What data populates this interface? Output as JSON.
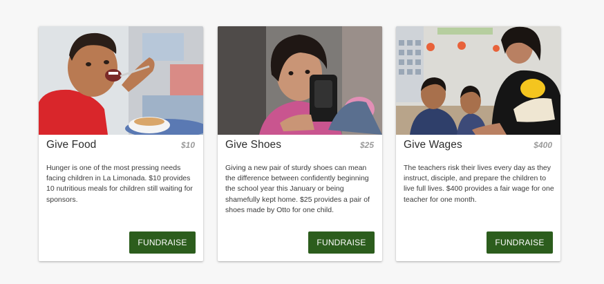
{
  "cards": [
    {
      "image": "boy-eating-food-photo",
      "title": "Give Food",
      "amount": "$10",
      "description": "Hunger is one of the most pressing needs facing children in La Limonada. $10 provides 10 nutritious meals for children still waiting for sponsors.",
      "button_label": "FUNDRAISE"
    },
    {
      "image": "girl-holding-shoes-photo",
      "title": "Give Shoes",
      "amount": "$25",
      "description": "Giving a new pair of sturdy shoes can mean the difference between confidently beginning the school year this January or being shamefully kept home. $25 provides a pair of shoes made by Otto for one child.",
      "button_label": "FUNDRAISE"
    },
    {
      "image": "teacher-with-children-photo",
      "title": "Give Wages",
      "amount": "$400",
      "description": "The teachers risk their lives every day as they instruct, disciple, and prepare the children to live full lives. $400 provides a fair wage for one teacher for one month.",
      "button_label": "FUNDRAISE"
    }
  ],
  "colors": {
    "button_bg": "#2c5d1d",
    "amount_text": "#9a9a9a",
    "page_bg": "#f7f7f7"
  }
}
